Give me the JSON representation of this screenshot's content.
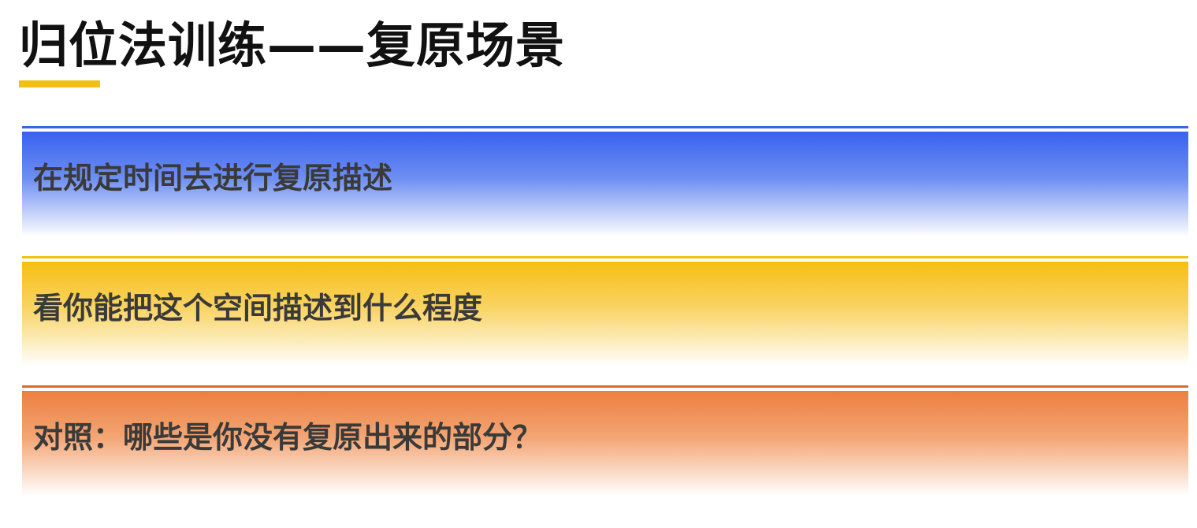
{
  "slide": {
    "title": "归位法训练——复原场景",
    "accent_color": "#f2c014",
    "items": [
      {
        "text": "在规定时间去进行复原描述",
        "color": "#3862ef"
      },
      {
        "text": "看你能把这个空间描述到什么程度",
        "color": "#f6bf12"
      },
      {
        "text": "对照：哪些是你没有复原出来的部分？",
        "color": "#ec7f3f"
      }
    ]
  }
}
